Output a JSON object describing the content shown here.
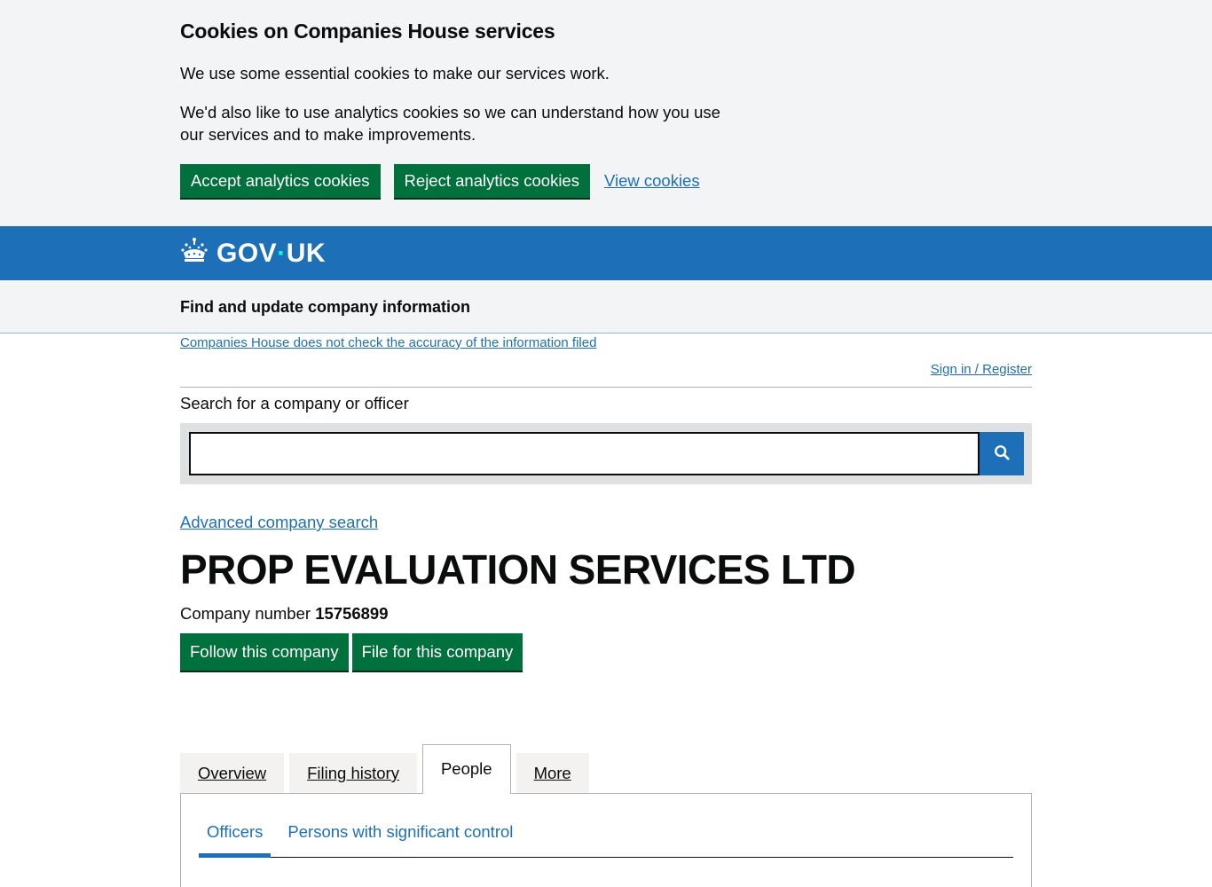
{
  "cookie_banner": {
    "title": "Cookies on Companies House services",
    "para1": "We use some essential cookies to make our services work.",
    "para2": "We'd also like to use analytics cookies so we can understand how you use our services and to make improvements.",
    "accept_label": "Accept analytics cookies",
    "reject_label": "Reject analytics cookies",
    "view_label": "View cookies"
  },
  "header": {
    "logo_text_left": "GOV",
    "logo_dot": "·",
    "logo_text_right": "UK",
    "logo_icon": "crown-icon",
    "service_name": "Find and update company information"
  },
  "notices": {
    "accuracy_link": "Companies House does not check the accuracy of the information filed",
    "signin_link": "Sign in / Register"
  },
  "search": {
    "label": "Search for a company or officer",
    "value": "",
    "button_icon": "search-icon",
    "advanced_link": "Advanced company search"
  },
  "company": {
    "name": "PROP EVALUATION SERVICES LTD",
    "number_label": "Company number",
    "number": "15756899",
    "follow_label": "Follow this company",
    "file_label": "File for this company"
  },
  "tabs": [
    {
      "label": "Overview",
      "active": false
    },
    {
      "label": "Filing history",
      "active": false
    },
    {
      "label": "People",
      "active": true
    },
    {
      "label": "More",
      "active": false
    }
  ],
  "subnav": [
    {
      "label": "Officers",
      "active": true
    },
    {
      "label": "Persons with significant control",
      "active": false
    }
  ],
  "colors": {
    "govuk_blue": "#1d70b8",
    "button_green": "#00703c",
    "banner_bg": "#f2f4f6"
  }
}
